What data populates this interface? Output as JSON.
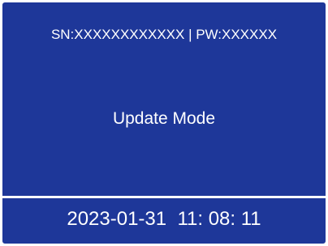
{
  "colors": {
    "background": "#1e3799",
    "text": "#ffffff",
    "divider": "#ffffff"
  },
  "header": {
    "info_text": "SN:XXXXXXXXXXXX | PW:XXXXXX"
  },
  "main": {
    "mode_label": "Update Mode"
  },
  "footer": {
    "datetime": "2023-01-31  11: 08: 11"
  }
}
